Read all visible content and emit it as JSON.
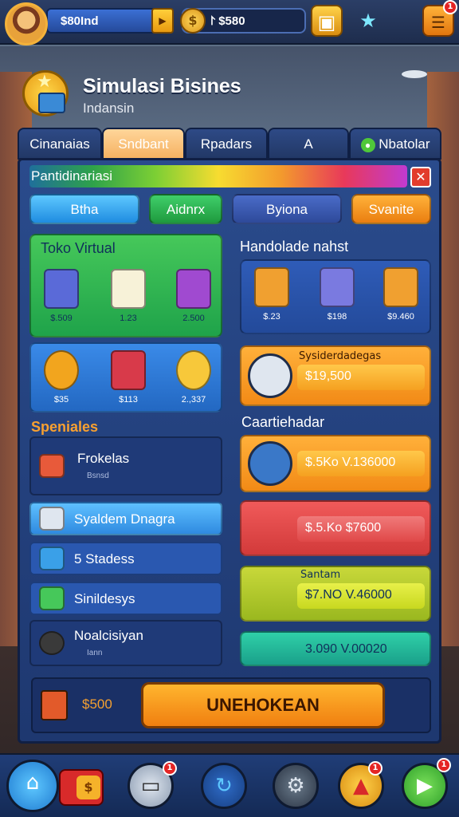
{
  "topbar": {
    "coins": "$80Ind",
    "gems": "$580",
    "coin_symbol": "$",
    "gem_prefix": "⨡",
    "notif_count": "1"
  },
  "header": {
    "title": "Simulasi Bisines",
    "subtitle": "Indansin"
  },
  "tabs": [
    "Cinanaias",
    "Sndbant",
    "Rpadars",
    "A",
    "Nbatolar"
  ],
  "panel": {
    "progress_label": "Pantidinariasi",
    "pills": [
      "Btha",
      "Aidnrx",
      "Byiona",
      "Svanite"
    ],
    "toko_virtual": {
      "title": "Toko Virtual",
      "items": [
        {
          "price": "$.509",
          "icon": "cabinet-icon"
        },
        {
          "price": "1.23",
          "icon": "box-icon"
        },
        {
          "price": "2.500",
          "icon": "shop-icon"
        }
      ],
      "items_row2": [
        {
          "price": "$35",
          "icon": "coin-icon"
        },
        {
          "price": "$113",
          "icon": "store-icon"
        },
        {
          "price": "2.,337",
          "icon": "token-icon"
        }
      ]
    },
    "handolade": {
      "title": "Handolade nahst",
      "items": [
        {
          "price": "$.23",
          "icon": "crate-icon"
        },
        {
          "price": "$198",
          "icon": "machine-icon"
        },
        {
          "price": "$9.460",
          "icon": "gift-box-icon"
        }
      ]
    },
    "speniales": {
      "title": "Speniales",
      "items": [
        {
          "label": "Frokelas",
          "sub": "Bsnsd"
        },
        {
          "label": "Syaldem Dnagra"
        },
        {
          "label": "5 Stadess"
        },
        {
          "label": "Sinildesys"
        },
        {
          "label": "Noalcisiyan",
          "sub": "Iann"
        }
      ]
    },
    "offers": [
      {
        "label": "Sysiderdadegas",
        "price": "$19,500"
      },
      {
        "label": "",
        "price": "$.5Ko V.136000"
      },
      {
        "label": "",
        "price": "$.5.Ko $7600"
      },
      {
        "label": "Santam",
        "price": "$7.NO V.46000"
      },
      {
        "label": "",
        "price": "3.090 V.00020"
      }
    ],
    "caartiehadar": "Caartiehadar",
    "bottom_price": "$500",
    "buy_label": "UNEHOKEAN"
  },
  "bottom_nav": {
    "badge_count": "1",
    "badge_count_2": "1",
    "badge_count_3": "1"
  }
}
